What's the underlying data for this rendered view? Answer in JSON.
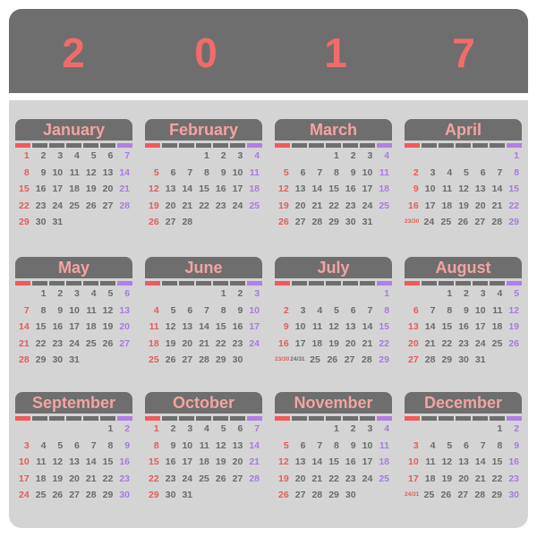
{
  "year_digits": [
    "2",
    "0",
    "1",
    "7"
  ],
  "colors": {
    "header": "#6e6e6e",
    "panel": "#d4d4d4",
    "year": "#f26b6b",
    "month_title": "#f4a3a3",
    "sunday": "#e85a5a",
    "weekday": "#6a6a6a",
    "saturday": "#a77be0"
  },
  "months": [
    {
      "name": "January",
      "weeks": [
        [
          "1",
          "2",
          "3",
          "4",
          "5",
          "6",
          "7"
        ],
        [
          "8",
          "9",
          "10",
          "11",
          "12",
          "13",
          "14"
        ],
        [
          "15",
          "16",
          "17",
          "18",
          "19",
          "20",
          "21"
        ],
        [
          "22",
          "23",
          "24",
          "25",
          "26",
          "27",
          "28"
        ],
        [
          "29",
          "30",
          "31",
          "",
          "",
          "",
          ""
        ]
      ]
    },
    {
      "name": "February",
      "weeks": [
        [
          "",
          "",
          "",
          "1",
          "2",
          "3",
          "4"
        ],
        [
          "5",
          "6",
          "7",
          "8",
          "9",
          "10",
          "11"
        ],
        [
          "12",
          "13",
          "14",
          "15",
          "16",
          "17",
          "18"
        ],
        [
          "19",
          "20",
          "21",
          "22",
          "23",
          "24",
          "25"
        ],
        [
          "26",
          "27",
          "28",
          "",
          "",
          "",
          ""
        ]
      ]
    },
    {
      "name": "March",
      "weeks": [
        [
          "",
          "",
          "",
          "1",
          "2",
          "3",
          "4"
        ],
        [
          "5",
          "6",
          "7",
          "8",
          "9",
          "10",
          "11"
        ],
        [
          "12",
          "13",
          "14",
          "15",
          "16",
          "17",
          "18"
        ],
        [
          "19",
          "20",
          "21",
          "22",
          "23",
          "24",
          "25"
        ],
        [
          "26",
          "27",
          "28",
          "29",
          "30",
          "31",
          ""
        ]
      ]
    },
    {
      "name": "April",
      "weeks": [
        [
          "",
          "",
          "",
          "",
          "",
          "",
          "1"
        ],
        [
          "2",
          "3",
          "4",
          "5",
          "6",
          "7",
          "8"
        ],
        [
          "9",
          "10",
          "11",
          "12",
          "13",
          "14",
          "15"
        ],
        [
          "16",
          "17",
          "18",
          "19",
          "20",
          "21",
          "22"
        ],
        [
          "23/30",
          "24",
          "25",
          "26",
          "27",
          "28",
          "29"
        ]
      ]
    },
    {
      "name": "May",
      "weeks": [
        [
          "",
          "1",
          "2",
          "3",
          "4",
          "5",
          "6"
        ],
        [
          "7",
          "8",
          "9",
          "10",
          "11",
          "12",
          "13"
        ],
        [
          "14",
          "15",
          "16",
          "17",
          "18",
          "19",
          "20"
        ],
        [
          "21",
          "22",
          "23",
          "24",
          "25",
          "26",
          "27"
        ],
        [
          "28",
          "29",
          "30",
          "31",
          "",
          "",
          ""
        ]
      ]
    },
    {
      "name": "June",
      "weeks": [
        [
          "",
          "",
          "",
          "",
          "1",
          "2",
          "3"
        ],
        [
          "4",
          "5",
          "6",
          "7",
          "8",
          "9",
          "10"
        ],
        [
          "11",
          "12",
          "13",
          "14",
          "15",
          "16",
          "17"
        ],
        [
          "18",
          "19",
          "20",
          "21",
          "22",
          "23",
          "24"
        ],
        [
          "25",
          "26",
          "27",
          "28",
          "29",
          "30",
          ""
        ]
      ]
    },
    {
      "name": "July",
      "weeks": [
        [
          "",
          "",
          "",
          "",
          "",
          "",
          "1"
        ],
        [
          "2",
          "3",
          "4",
          "5",
          "6",
          "7",
          "8"
        ],
        [
          "9",
          "10",
          "11",
          "12",
          "13",
          "14",
          "15"
        ],
        [
          "16",
          "17",
          "18",
          "19",
          "20",
          "21",
          "22"
        ],
        [
          "23/30",
          "24/31",
          "25",
          "26",
          "27",
          "28",
          "29"
        ]
      ]
    },
    {
      "name": "August",
      "weeks": [
        [
          "",
          "",
          "1",
          "2",
          "3",
          "4",
          "5"
        ],
        [
          "6",
          "7",
          "8",
          "9",
          "10",
          "11",
          "12"
        ],
        [
          "13",
          "14",
          "15",
          "16",
          "17",
          "18",
          "19"
        ],
        [
          "20",
          "21",
          "22",
          "23",
          "24",
          "25",
          "26"
        ],
        [
          "27",
          "28",
          "29",
          "30",
          "31",
          "",
          ""
        ]
      ]
    },
    {
      "name": "September",
      "weeks": [
        [
          "",
          "",
          "",
          "",
          "",
          "1",
          "2"
        ],
        [
          "3",
          "4",
          "5",
          "6",
          "7",
          "8",
          "9"
        ],
        [
          "10",
          "11",
          "12",
          "13",
          "14",
          "15",
          "16"
        ],
        [
          "17",
          "18",
          "19",
          "20",
          "21",
          "22",
          "23"
        ],
        [
          "24",
          "25",
          "26",
          "27",
          "28",
          "29",
          "30"
        ]
      ]
    },
    {
      "name": "October",
      "weeks": [
        [
          "1",
          "2",
          "3",
          "4",
          "5",
          "6",
          "7"
        ],
        [
          "8",
          "9",
          "10",
          "11",
          "12",
          "13",
          "14"
        ],
        [
          "15",
          "16",
          "17",
          "18",
          "19",
          "20",
          "21"
        ],
        [
          "22",
          "23",
          "24",
          "25",
          "26",
          "27",
          "28"
        ],
        [
          "29",
          "30",
          "31",
          "",
          "",
          "",
          ""
        ]
      ]
    },
    {
      "name": "November",
      "weeks": [
        [
          "",
          "",
          "",
          "1",
          "2",
          "3",
          "4"
        ],
        [
          "5",
          "6",
          "7",
          "8",
          "9",
          "10",
          "11"
        ],
        [
          "12",
          "13",
          "14",
          "15",
          "16",
          "17",
          "18"
        ],
        [
          "19",
          "20",
          "21",
          "22",
          "23",
          "24",
          "25"
        ],
        [
          "26",
          "27",
          "28",
          "29",
          "30",
          "",
          ""
        ]
      ]
    },
    {
      "name": "December",
      "weeks": [
        [
          "",
          "",
          "",
          "",
          "",
          "1",
          "2"
        ],
        [
          "3",
          "4",
          "5",
          "6",
          "7",
          "8",
          "9"
        ],
        [
          "10",
          "11",
          "12",
          "13",
          "14",
          "15",
          "16"
        ],
        [
          "17",
          "18",
          "19",
          "20",
          "21",
          "22",
          "23"
        ],
        [
          "24/31",
          "25",
          "26",
          "27",
          "28",
          "29",
          "30"
        ]
      ]
    }
  ]
}
